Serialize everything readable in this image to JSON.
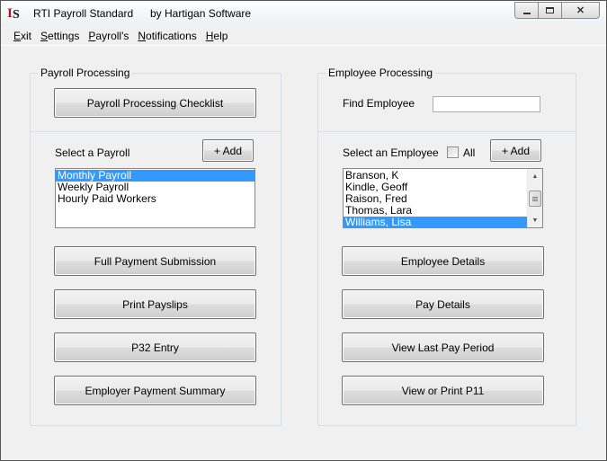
{
  "window": {
    "title": "RTI Payroll Standard",
    "subtitle": "by Hartigan Software",
    "icon": "app-logo-icon",
    "controls": {
      "minimize": "minimize-icon",
      "maximize": "maximize-icon",
      "close": "close-icon"
    }
  },
  "menu": [
    {
      "label_u": "E",
      "label_rest": "xit"
    },
    {
      "label_u": "S",
      "label_rest": "ettings"
    },
    {
      "label_u": "P",
      "label_rest": "ayroll's"
    },
    {
      "label_u": "N",
      "label_rest": "otifications"
    },
    {
      "label_u": "H",
      "label_rest": "elp"
    }
  ],
  "payroll": {
    "group_title": "Payroll Processing",
    "checklist_button": "Payroll Processing Checklist",
    "select_label": "Select a Payroll",
    "add_button": "+ Add",
    "payrolls": [
      "Monthly Payroll",
      "Weekly Payroll",
      "Hourly Paid Workers"
    ],
    "selected_index": 0,
    "actions": [
      "Full Payment Submission",
      "Print Payslips",
      "P32 Entry",
      "Employer Payment Summary"
    ]
  },
  "employee": {
    "group_title": "Employee Processing",
    "find_label": "Find Employee",
    "find_value": "",
    "select_label": "Select an Employee",
    "all_label": "All",
    "all_checked": false,
    "add_button": "+ Add",
    "employees": [
      "Branson, K",
      "Kindle, Geoff",
      "Raison, Fred",
      "Thomas, Lara",
      "Williams, Lisa"
    ],
    "selected_index": 4,
    "actions": [
      "Employee Details",
      "Pay Details",
      "View Last Pay Period",
      "View or Print P11"
    ]
  }
}
